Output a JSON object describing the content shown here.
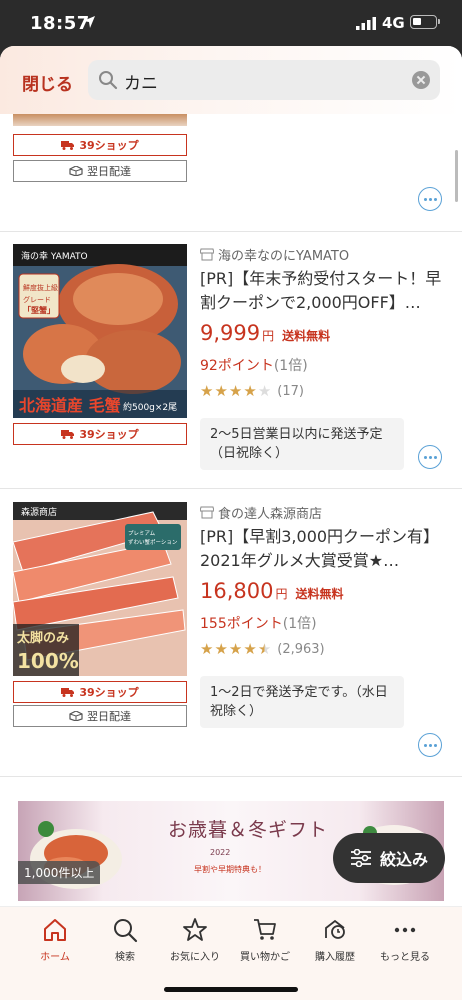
{
  "status_bar": {
    "time": "18:57",
    "network": "4G"
  },
  "header": {
    "close_label": "閉じる",
    "search_value": "カニ",
    "search_icon": "search-icon",
    "clear_icon": "clear-icon"
  },
  "top_partial": {
    "tags": {
      "shop39": "39ショップ",
      "next_day": "翌日配達"
    }
  },
  "products": [
    {
      "shop": "海の幸なのにYAMATO",
      "title": "[PR]【年末予約受付スタート！早割クーポンで2,000円OFF】…",
      "price": "9,999",
      "yen": "円",
      "shipping": "送料無料",
      "points": "92ポイント",
      "points_mult": "(1倍)",
      "rating": 4,
      "rating_count": "(17)",
      "delivery": "2〜5日営業日以内に発送予定（日祝除く）",
      "tags": [
        "39ショップ"
      ],
      "image_text": {
        "brand": "海の幸 YAMATO",
        "badge": "鮮度抜上級グレード「堅蟹」",
        "caption": "北海道産 毛蟹",
        "amount": "約500g×2尾"
      }
    },
    {
      "shop": "食の達人森源商店",
      "title": "[PR]【早割3,000円クーポン有】2021年グルメ大賞受賞★…",
      "price": "16,800",
      "yen": "円",
      "shipping": "送料無料",
      "points": "155ポイント",
      "points_mult": "(1倍)",
      "rating": 4.5,
      "rating_count": "(2,963)",
      "delivery": "1〜2日で発送予定です。（水日祝除く）",
      "tags": [
        "39ショップ",
        "翌日配達"
      ],
      "image_text": {
        "brand": "森源商店",
        "badge": "プレミアム ずわい蟹ポーション",
        "caption": "太脚のみ",
        "amount": "100%"
      }
    }
  ],
  "banner": {
    "title": "お歳暮＆冬ギフト",
    "year": "2022",
    "subtitle": "早割や早期特典も！",
    "count": "1,000件以上"
  },
  "filter_button": {
    "label": "絞込み",
    "icon": "filter-icon"
  },
  "bottom_nav": [
    {
      "label": "ホーム",
      "icon": "home-icon",
      "active": true
    },
    {
      "label": "検索",
      "icon": "search-icon"
    },
    {
      "label": "お気に入り",
      "icon": "star-icon"
    },
    {
      "label": "買い物かご",
      "icon": "cart-icon"
    },
    {
      "label": "購入履歴",
      "icon": "history-icon"
    },
    {
      "label": "もっと見る",
      "icon": "more-icon"
    }
  ],
  "colors": {
    "accent": "#c7341f",
    "link_blue": "#5aa1d6",
    "star": "#d6a24a"
  }
}
